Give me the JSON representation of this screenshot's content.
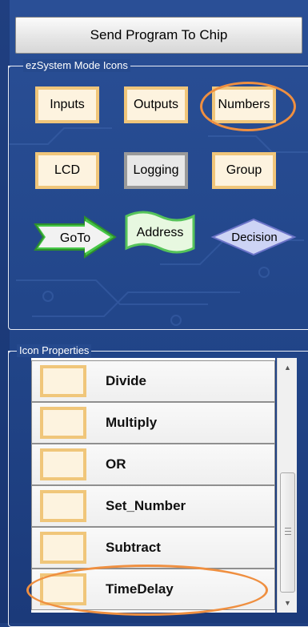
{
  "toolbar": {
    "send_label": "Send Program To Chip"
  },
  "mode_panel": {
    "title": "ezSystem Mode Icons",
    "buttons": [
      "Inputs",
      "Outputs",
      "Numbers",
      "LCD",
      "Logging",
      "Group"
    ],
    "flow_shapes": {
      "goto": "GoTo",
      "address": "Address",
      "decision": "Decision"
    }
  },
  "properties_panel": {
    "title": "Icon Properties",
    "items": [
      "Divide",
      "Multiply",
      "OR",
      "Set_Number",
      "Subtract",
      "TimeDelay"
    ]
  },
  "scroll": {
    "up": "▲",
    "down": "▼"
  },
  "colors": {
    "background": "#1f3f80",
    "icon_border": "#f0c67a",
    "icon_fill": "#fdf3df",
    "goto_fill": "#48c848",
    "address_fill": "#e7f8e0",
    "decision_fill": "#cdd3f5",
    "highlight": "#ef8f40"
  }
}
